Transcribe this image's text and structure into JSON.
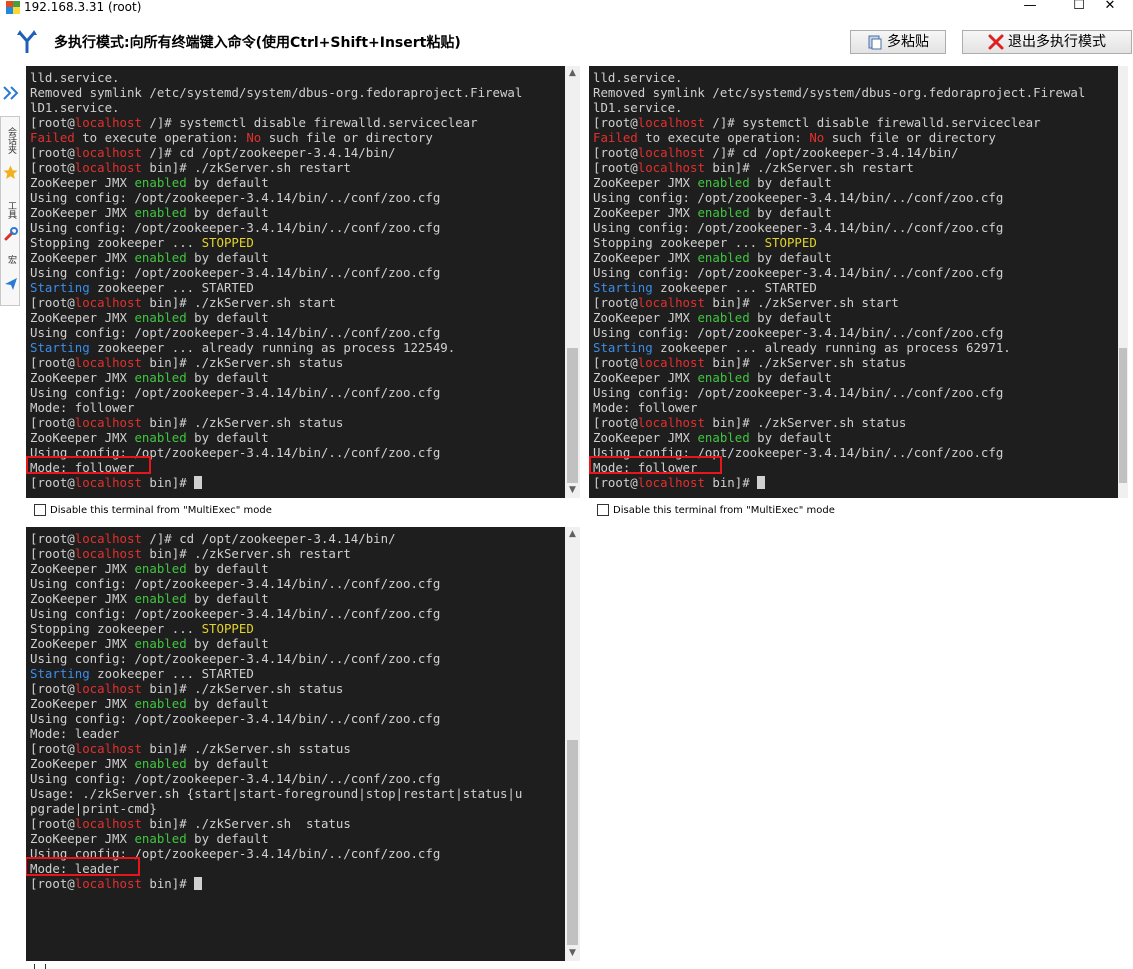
{
  "window": {
    "title": "192.168.3.31 (root)",
    "minimize": "—",
    "maximize": "☐",
    "close": "✕"
  },
  "toolbar": {
    "mode_text": "多执行模式:向所有终端键入命令(使用Ctrl+Shift+Insert粘贴)",
    "paste_label": "多粘贴",
    "exit_label": "退出多执行模式"
  },
  "sidebar": {
    "labels": [
      "会话夹",
      "工具",
      "宏"
    ],
    "colors": {
      "expand": "#2a7ad5",
      "star": "#f2b01e",
      "tool": "#d7332b",
      "send": "#2a7ad5"
    }
  },
  "terminals": {
    "top_left": {
      "lines": [
        [
          [
            "lld.service.",
            ""
          ]
        ],
        [
          [
            "Removed symlink /etc/systemd/system/dbus-org.fedoraproject.Firewal",
            ""
          ]
        ],
        [
          [
            "lD1.service.",
            ""
          ]
        ],
        [
          [
            "[root@",
            ""
          ],
          [
            "localhost",
            "red"
          ],
          [
            " /]# systemctl disable firewalld.serviceclear",
            ""
          ]
        ],
        [
          [
            "Failed",
            "red"
          ],
          [
            " to execute operation: ",
            ""
          ],
          [
            "No",
            "red"
          ],
          [
            " such file or directory",
            ""
          ]
        ],
        [
          [
            "[root@",
            ""
          ],
          [
            "localhost",
            "red"
          ],
          [
            " /]# cd /opt/zookeeper-3.4.14/bin/",
            ""
          ]
        ],
        [
          [
            "[root@",
            ""
          ],
          [
            "localhost",
            "red"
          ],
          [
            " bin]# ./zkServer.sh restart",
            ""
          ]
        ],
        [
          [
            "ZooKeeper JMX ",
            ""
          ],
          [
            "enabled",
            "green"
          ],
          [
            " by default",
            ""
          ]
        ],
        [
          [
            "Using config: /opt/zookeeper-3.4.14/bin/../conf/zoo.cfg",
            ""
          ]
        ],
        [
          [
            "ZooKeeper JMX ",
            ""
          ],
          [
            "enabled",
            "green"
          ],
          [
            " by default",
            ""
          ]
        ],
        [
          [
            "Using config: /opt/zookeeper-3.4.14/bin/../conf/zoo.cfg",
            ""
          ]
        ],
        [
          [
            "Stopping zookeeper ... ",
            ""
          ],
          [
            "STOPPED",
            "yellow"
          ]
        ],
        [
          [
            "ZooKeeper JMX ",
            ""
          ],
          [
            "enabled",
            "green"
          ],
          [
            " by default",
            ""
          ]
        ],
        [
          [
            "Using config: /opt/zookeeper-3.4.14/bin/../conf/zoo.cfg",
            ""
          ]
        ],
        [
          [
            "Starting",
            "blue"
          ],
          [
            " zookeeper ... STARTED",
            ""
          ]
        ],
        [
          [
            "[root@",
            ""
          ],
          [
            "localhost",
            "red"
          ],
          [
            " bin]# ./zkServer.sh start",
            ""
          ]
        ],
        [
          [
            "ZooKeeper JMX ",
            ""
          ],
          [
            "enabled",
            "green"
          ],
          [
            " by default",
            ""
          ]
        ],
        [
          [
            "Using config: /opt/zookeeper-3.4.14/bin/../conf/zoo.cfg",
            ""
          ]
        ],
        [
          [
            "Starting",
            "blue"
          ],
          [
            " zookeeper ... already running as process 122549.",
            ""
          ]
        ],
        [
          [
            "[root@",
            ""
          ],
          [
            "localhost",
            "red"
          ],
          [
            " bin]# ./zkServer.sh status",
            ""
          ]
        ],
        [
          [
            "ZooKeeper JMX ",
            ""
          ],
          [
            "enabled",
            "green"
          ],
          [
            " by default",
            ""
          ]
        ],
        [
          [
            "Using config: /opt/zookeeper-3.4.14/bin/../conf/zoo.cfg",
            ""
          ]
        ],
        [
          [
            "Mode: follower",
            ""
          ]
        ],
        [
          [
            "[root@",
            ""
          ],
          [
            "localhost",
            "red"
          ],
          [
            " bin]# ./zkServer.sh status",
            ""
          ]
        ],
        [
          [
            "ZooKeeper JMX ",
            ""
          ],
          [
            "enabled",
            "green"
          ],
          [
            " by default",
            ""
          ]
        ],
        [
          [
            "Using config: /opt/zookeeper-3.4.14/bin/../conf/zoo.cfg",
            ""
          ]
        ],
        [
          [
            "Mode: follower",
            ""
          ]
        ],
        [
          [
            "[root@",
            ""
          ],
          [
            "localhost",
            "red"
          ],
          [
            " bin]# ",
            ""
          ],
          [
            "",
            "cursor"
          ]
        ]
      ]
    },
    "top_right": {
      "lines": [
        [
          [
            "lld.service.",
            ""
          ]
        ],
        [
          [
            "Removed symlink /etc/systemd/system/dbus-org.fedoraproject.Firewal",
            ""
          ]
        ],
        [
          [
            "lD1.service.",
            ""
          ]
        ],
        [
          [
            "[root@",
            ""
          ],
          [
            "localhost",
            "red"
          ],
          [
            " /]# systemctl disable firewalld.serviceclear",
            ""
          ]
        ],
        [
          [
            "Failed",
            "red"
          ],
          [
            " to execute operation: ",
            ""
          ],
          [
            "No",
            "red"
          ],
          [
            " such file or directory",
            ""
          ]
        ],
        [
          [
            "[root@",
            ""
          ],
          [
            "localhost",
            "red"
          ],
          [
            " /]# cd /opt/zookeeper-3.4.14/bin/",
            ""
          ]
        ],
        [
          [
            "[root@",
            ""
          ],
          [
            "localhost",
            "red"
          ],
          [
            " bin]# ./zkServer.sh restart",
            ""
          ]
        ],
        [
          [
            "ZooKeeper JMX ",
            ""
          ],
          [
            "enabled",
            "green"
          ],
          [
            " by default",
            ""
          ]
        ],
        [
          [
            "Using config: /opt/zookeeper-3.4.14/bin/../conf/zoo.cfg",
            ""
          ]
        ],
        [
          [
            "ZooKeeper JMX ",
            ""
          ],
          [
            "enabled",
            "green"
          ],
          [
            " by default",
            ""
          ]
        ],
        [
          [
            "Using config: /opt/zookeeper-3.4.14/bin/../conf/zoo.cfg",
            ""
          ]
        ],
        [
          [
            "Stopping zookeeper ... ",
            ""
          ],
          [
            "STOPPED",
            "yellow"
          ]
        ],
        [
          [
            "ZooKeeper JMX ",
            ""
          ],
          [
            "enabled",
            "green"
          ],
          [
            " by default",
            ""
          ]
        ],
        [
          [
            "Using config: /opt/zookeeper-3.4.14/bin/../conf/zoo.cfg",
            ""
          ]
        ],
        [
          [
            "Starting",
            "blue"
          ],
          [
            " zookeeper ... STARTED",
            ""
          ]
        ],
        [
          [
            "[root@",
            ""
          ],
          [
            "localhost",
            "red"
          ],
          [
            " bin]# ./zkServer.sh start",
            ""
          ]
        ],
        [
          [
            "ZooKeeper JMX ",
            ""
          ],
          [
            "enabled",
            "green"
          ],
          [
            " by default",
            ""
          ]
        ],
        [
          [
            "Using config: /opt/zookeeper-3.4.14/bin/../conf/zoo.cfg",
            ""
          ]
        ],
        [
          [
            "Starting",
            "blue"
          ],
          [
            " zookeeper ... already running as process 62971.",
            ""
          ]
        ],
        [
          [
            "[root@",
            ""
          ],
          [
            "localhost",
            "red"
          ],
          [
            " bin]# ./zkServer.sh status",
            ""
          ]
        ],
        [
          [
            "ZooKeeper JMX ",
            ""
          ],
          [
            "enabled",
            "green"
          ],
          [
            " by default",
            ""
          ]
        ],
        [
          [
            "Using config: /opt/zookeeper-3.4.14/bin/../conf/zoo.cfg",
            ""
          ]
        ],
        [
          [
            "Mode: follower",
            ""
          ]
        ],
        [
          [
            "[root@",
            ""
          ],
          [
            "localhost",
            "red"
          ],
          [
            " bin]# ./zkServer.sh status",
            ""
          ]
        ],
        [
          [
            "ZooKeeper JMX ",
            ""
          ],
          [
            "enabled",
            "green"
          ],
          [
            " by default",
            ""
          ]
        ],
        [
          [
            "Using config: /opt/zookeeper-3.4.14/bin/../conf/zoo.cfg",
            ""
          ]
        ],
        [
          [
            "Mode: follower",
            ""
          ]
        ],
        [
          [
            "[root@",
            ""
          ],
          [
            "localhost",
            "red"
          ],
          [
            " bin]# ",
            ""
          ],
          [
            "",
            "cursor"
          ]
        ]
      ]
    },
    "bottom_left": {
      "lines": [
        [
          [
            "[root@",
            ""
          ],
          [
            "localhost",
            "red"
          ],
          [
            " /]# cd /opt/zookeeper-3.4.14/bin/",
            ""
          ]
        ],
        [
          [
            "[root@",
            ""
          ],
          [
            "localhost",
            "red"
          ],
          [
            " bin]# ./zkServer.sh restart",
            ""
          ]
        ],
        [
          [
            "ZooKeeper JMX ",
            ""
          ],
          [
            "enabled",
            "green"
          ],
          [
            " by default",
            ""
          ]
        ],
        [
          [
            "Using config: /opt/zookeeper-3.4.14/bin/../conf/zoo.cfg",
            ""
          ]
        ],
        [
          [
            "ZooKeeper JMX ",
            ""
          ],
          [
            "enabled",
            "green"
          ],
          [
            " by default",
            ""
          ]
        ],
        [
          [
            "Using config: /opt/zookeeper-3.4.14/bin/../conf/zoo.cfg",
            ""
          ]
        ],
        [
          [
            "Stopping zookeeper ... ",
            ""
          ],
          [
            "STOPPED",
            "yellow"
          ]
        ],
        [
          [
            "ZooKeeper JMX ",
            ""
          ],
          [
            "enabled",
            "green"
          ],
          [
            " by default",
            ""
          ]
        ],
        [
          [
            "Using config: /opt/zookeeper-3.4.14/bin/../conf/zoo.cfg",
            ""
          ]
        ],
        [
          [
            "Starting",
            "blue"
          ],
          [
            " zookeeper ... STARTED",
            ""
          ]
        ],
        [
          [
            "[root@",
            ""
          ],
          [
            "localhost",
            "red"
          ],
          [
            " bin]# ./zkServer.sh status",
            ""
          ]
        ],
        [
          [
            "ZooKeeper JMX ",
            ""
          ],
          [
            "enabled",
            "green"
          ],
          [
            " by default",
            ""
          ]
        ],
        [
          [
            "Using config: /opt/zookeeper-3.4.14/bin/../conf/zoo.cfg",
            ""
          ]
        ],
        [
          [
            "Mode: leader",
            ""
          ]
        ],
        [
          [
            "[root@",
            ""
          ],
          [
            "localhost",
            "red"
          ],
          [
            " bin]# ./zkServer.sh sstatus",
            ""
          ]
        ],
        [
          [
            "ZooKeeper JMX ",
            ""
          ],
          [
            "enabled",
            "green"
          ],
          [
            " by default",
            ""
          ]
        ],
        [
          [
            "Using config: /opt/zookeeper-3.4.14/bin/../conf/zoo.cfg",
            ""
          ]
        ],
        [
          [
            "Usage: ./zkServer.sh {start|start-foreground|stop|restart|status|u",
            ""
          ]
        ],
        [
          [
            "pgrade|print-cmd}",
            ""
          ]
        ],
        [
          [
            "[root@",
            ""
          ],
          [
            "localhost",
            "red"
          ],
          [
            " bin]# ./zkServer.sh  status",
            ""
          ]
        ],
        [
          [
            "ZooKeeper JMX ",
            ""
          ],
          [
            "enabled",
            "green"
          ],
          [
            " by default",
            ""
          ]
        ],
        [
          [
            "Using config: /opt/zookeeper-3.4.14/bin/../conf/zoo.cfg",
            ""
          ]
        ],
        [
          [
            "Mode: leader",
            ""
          ]
        ],
        [
          [
            "[root@",
            ""
          ],
          [
            "localhost",
            "red"
          ],
          [
            " bin]# ",
            ""
          ],
          [
            "",
            "cursor"
          ]
        ]
      ]
    }
  },
  "disable_label": "Disable this terminal from \"MultiExec\" mode",
  "scroll": {
    "up": "▲",
    "down": "▼"
  },
  "colors": {
    "terminal_bg": "#1e1e1e",
    "terminal_fg": "#d0d0d0",
    "host_red": "#e2302e",
    "enabled_green": "#3fc640",
    "stopped_yellow": "#e3d42a",
    "starting_blue": "#3b8ee8",
    "highlight_box": "#e8151b"
  }
}
